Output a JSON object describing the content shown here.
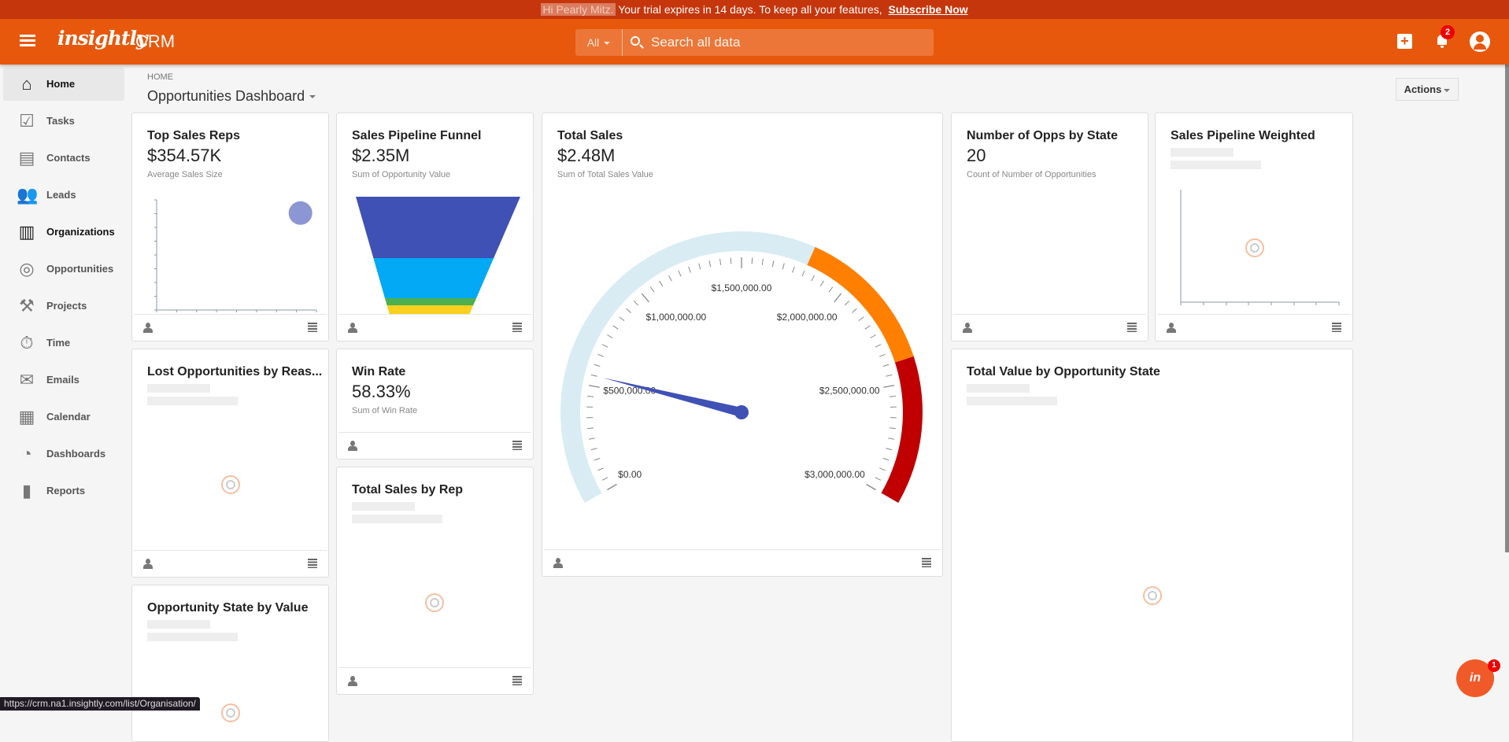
{
  "trial": {
    "greeting": "Hi Pearly Mitz.",
    "message": "Your trial expires in 14 days. To keep all your features,",
    "link": "Subscribe Now"
  },
  "header": {
    "logo": "insightly",
    "app": "CRM",
    "search_scope": "All",
    "search_placeholder": "Search all data",
    "notifications": "2"
  },
  "sidebar": {
    "items": [
      {
        "label": "Home",
        "icon": "⌂"
      },
      {
        "label": "Tasks",
        "icon": "☑"
      },
      {
        "label": "Contacts",
        "icon": "▤"
      },
      {
        "label": "Leads",
        "icon": "👥"
      },
      {
        "label": "Organizations",
        "icon": "▥"
      },
      {
        "label": "Opportunities",
        "icon": "◎"
      },
      {
        "label": "Projects",
        "icon": "⚒"
      },
      {
        "label": "Time",
        "icon": "⏱"
      },
      {
        "label": "Emails",
        "icon": "✉"
      },
      {
        "label": "Calendar",
        "icon": "▦"
      },
      {
        "label": "Dashboards",
        "icon": "◔"
      },
      {
        "label": "Reports",
        "icon": "▮"
      }
    ]
  },
  "page": {
    "breadcrumb": "HOME",
    "title": "Opportunities Dashboard",
    "actions": "Actions"
  },
  "cards": {
    "top_sales_reps": {
      "title": "Top Sales Reps",
      "value": "$354.57K",
      "subtitle": "Average Sales Size"
    },
    "funnel": {
      "title": "Sales Pipeline Funnel",
      "value": "$2.35M",
      "subtitle": "Sum of Opportunity Value"
    },
    "total_sales": {
      "title": "Total Sales",
      "value": "$2.48M",
      "subtitle": "Sum of Total Sales Value"
    },
    "opps_by_state": {
      "title": "Number of Opps by State",
      "value": "20",
      "subtitle": "Count of Number of Opportunities"
    },
    "pipeline_weighted": {
      "title": "Sales Pipeline Weighted"
    },
    "lost_opps": {
      "title": "Lost Opportunities by Reas..."
    },
    "win_rate": {
      "title": "Win Rate",
      "value": "58.33%",
      "subtitle": "Sum of Win Rate"
    },
    "sales_by_rep": {
      "title": "Total Sales by Rep"
    },
    "value_by_state": {
      "title": "Total Value by Opportunity State"
    },
    "state_by_value": {
      "title": "Opportunity State by Value"
    }
  },
  "chart_data": [
    {
      "type": "gauge",
      "title": "Total Sales",
      "min": 0,
      "max": 3000000,
      "value": 550000,
      "tick_labels": [
        "$0.00",
        "$500,000.00",
        "$1,000,000.00",
        "$1,500,000.00",
        "$2,000,000.00",
        "$2,500,000.00",
        "$3,000,000.00"
      ],
      "bands": [
        {
          "from": 0,
          "to": 1800000,
          "color": "#d9ecf4"
        },
        {
          "from": 1800000,
          "to": 2400000,
          "color": "#ff7f00"
        },
        {
          "from": 2400000,
          "to": 3000000,
          "color": "#c00000"
        }
      ],
      "needle_color": "#3f51b5"
    },
    {
      "type": "funnel",
      "title": "Sales Pipeline Funnel",
      "segments": [
        {
          "share": 0.52,
          "color": "#3f51b5"
        },
        {
          "share": 0.34,
          "color": "#03a9f4"
        },
        {
          "share": 0.06,
          "color": "#4caf50"
        },
        {
          "share": 0.08,
          "color": "#f9d01e"
        }
      ]
    },
    {
      "type": "scatter",
      "title": "Top Sales Reps",
      "points": [
        {
          "x": 0.9,
          "y": 0.88
        }
      ],
      "color": "#8c96d3"
    }
  ],
  "status_url": "https://crm.na1.insightly.com/list/Organisation/",
  "chat": {
    "label": "in",
    "badge": "1"
  }
}
